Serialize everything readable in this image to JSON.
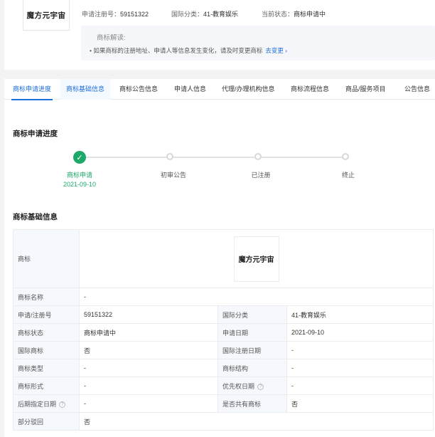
{
  "header": {
    "logo_text": "魔方元宇宙",
    "reg_no_label": "申请注册号：",
    "reg_no": "59151322",
    "class_label": "国际分类：",
    "class_value": "41-教育娱乐",
    "status_label": "当前状态：",
    "status_value": "商标申请中",
    "interpretation_title": "商标解读:",
    "interpretation_note": "• 如果商标的注册地址、申请人等信息发生变化，请及时变更商标",
    "interpretation_link": "去变更 ›"
  },
  "tabs": [
    {
      "label": "商标申请进度"
    },
    {
      "label": "商标基础信息"
    },
    {
      "label": "商标公告信息"
    },
    {
      "label": "申请人信息"
    },
    {
      "label": "代理/办理机构信息"
    },
    {
      "label": "商标流程信息"
    },
    {
      "label": "商品/服务项目"
    },
    {
      "label": "公告信息"
    }
  ],
  "progress": {
    "title": "商标申请进度",
    "steps": [
      {
        "label": "商标申请",
        "date": "2021-09-10",
        "done": true
      },
      {
        "label": "初审公告",
        "done": false
      },
      {
        "label": "已注册",
        "done": false
      },
      {
        "label": "终止",
        "done": false
      }
    ]
  },
  "basic": {
    "title": "商标基础信息",
    "trademark_label": "商标",
    "trademark_image_text": "魔方元宇宙",
    "name_label": "商标名称",
    "name_value": "-",
    "rows": [
      {
        "k1": "申请/注册号",
        "v1": "59151322",
        "k2": "国际分类",
        "v2": "41-教育娱乐"
      },
      {
        "k1": "商标状态",
        "v1": "商标申请中",
        "k2": "申请日期",
        "v2": "2021-09-10"
      },
      {
        "k1": "国际商标",
        "v1": "否",
        "k2": "国际注册日期",
        "v2": "-"
      },
      {
        "k1": "商标类型",
        "v1": "-",
        "k2": "商标结构",
        "v2": "-"
      },
      {
        "k1": "商标形式",
        "v1": "-",
        "k2": "优先权日期",
        "v2": "-"
      },
      {
        "k1": "后期指定日期",
        "v1": "-",
        "k2": "是否共有商标",
        "v2": "否"
      }
    ],
    "last_label": "部分驳回",
    "last_value": "否",
    "help_glyph": "?"
  },
  "colors": {
    "accent": "#1e6fd9",
    "success": "#1ea86a"
  }
}
